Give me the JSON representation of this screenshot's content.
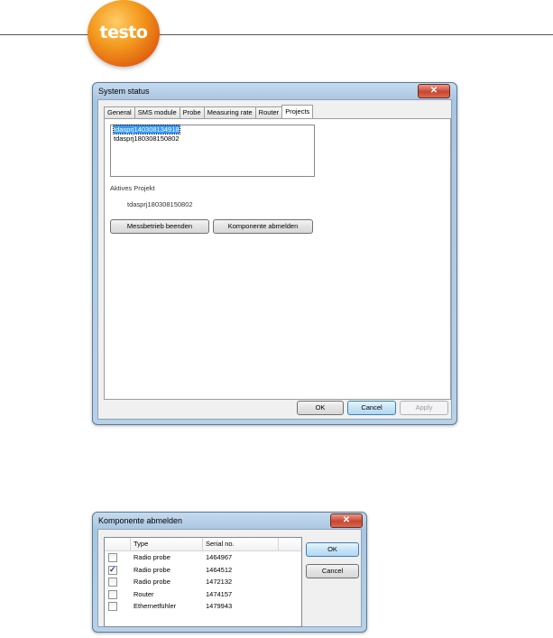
{
  "header": {
    "logo_text": "testo"
  },
  "system_status": {
    "title": "System status",
    "close_glyph": "✕",
    "tabs": [
      "General",
      "SMS module",
      "Probe",
      "Measuring rate",
      "Router",
      "Projects"
    ],
    "active_tab": "Projects",
    "projects": [
      "tdasprj140308134918",
      "tdasprj180308150802"
    ],
    "selected_project": "tdasprj140308134918",
    "active_project_label": "Aktives Projekt",
    "active_project_value": "tdasprj180308150802",
    "end_measurement_button": "Messbetrieb beenden",
    "unregister_button": "Komponente abmelden",
    "ok_button": "OK",
    "cancel_button": "Cancel",
    "apply_button": "Apply"
  },
  "unregister_dialog": {
    "title": "Komponente abmelden",
    "close_glyph": "✕",
    "columns": [
      "",
      "Type",
      "Serial no.",
      ""
    ],
    "rows": [
      {
        "checked": false,
        "type": "Radio probe",
        "serial": "1464967"
      },
      {
        "checked": true,
        "type": "Radio probe",
        "serial": "1464512"
      },
      {
        "checked": false,
        "type": "Radio probe",
        "serial": "1472132"
      },
      {
        "checked": false,
        "type": "Router",
        "serial": "1474157"
      },
      {
        "checked": false,
        "type": "Ethernetfühler",
        "serial": "1479943"
      }
    ],
    "ok_button": "OK",
    "cancel_button": "Cancel"
  }
}
